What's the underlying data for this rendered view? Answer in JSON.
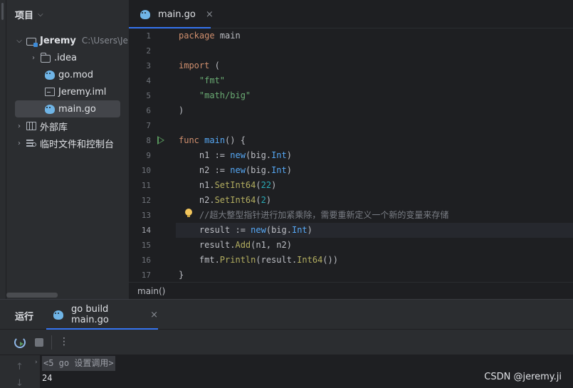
{
  "project_panel": {
    "title": "项目",
    "tree": [
      {
        "label": "Jeremy",
        "hint": "C:\\Users\\Jeremy",
        "icon": "module-folder-icon",
        "expanded": true
      },
      {
        "label": ".idea",
        "icon": "folder-icon",
        "expanded": false
      },
      {
        "label": "go.mod",
        "icon": "go-file-icon"
      },
      {
        "label": "Jeremy.iml",
        "icon": "iml-file-icon"
      },
      {
        "label": "main.go",
        "icon": "go-file-icon",
        "selected": true
      },
      {
        "label": "外部库",
        "icon": "library-icon",
        "expanded": false
      },
      {
        "label": "临时文件和控制台",
        "icon": "scratch-icon",
        "expanded": false
      }
    ]
  },
  "editor": {
    "tab": {
      "label": "main.go",
      "close": "×"
    },
    "current_line": 14,
    "line_numbers": [
      "1",
      "2",
      "3",
      "4",
      "5",
      "6",
      "7",
      "8",
      "9",
      "10",
      "11",
      "12",
      "13",
      "14",
      "15",
      "16",
      "17"
    ],
    "breadcrumb": "main()"
  },
  "run_panel": {
    "title": "运行",
    "tab_label": "go build main.go",
    "tab_close": "×",
    "folded_line": "<5 go 设置调用>",
    "output": "24"
  },
  "watermark": "CSDN @jeremy.ji",
  "colors": {
    "accent": "#3574f0",
    "keyword": "#cf8e6d",
    "string": "#6aab73",
    "number": "#2aacb8",
    "function": "#56a8f5",
    "method": "#b3ae60",
    "comment": "#7a7e85",
    "run_green": "#57965c"
  }
}
